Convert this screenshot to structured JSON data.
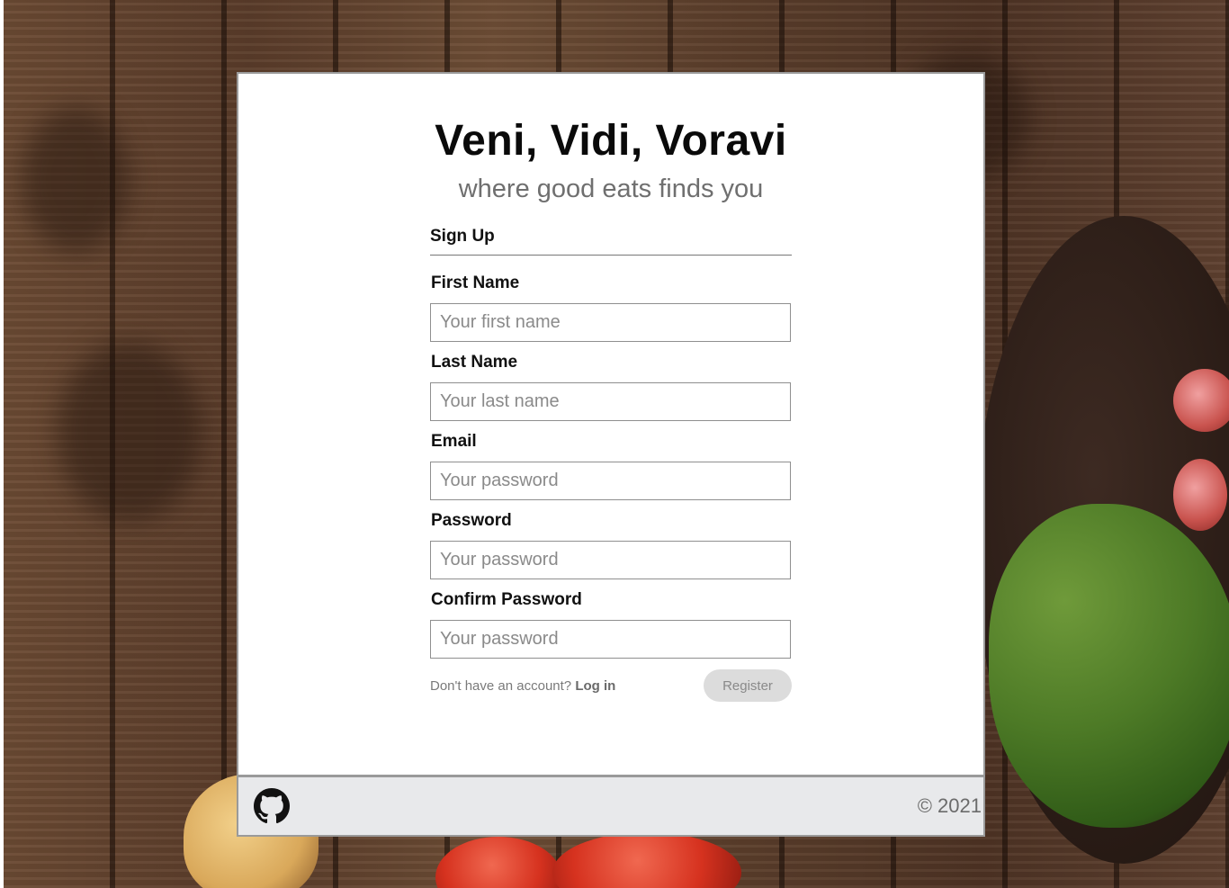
{
  "app": {
    "title": "Veni, Vidi, Voravi",
    "tagline": "where good eats finds you"
  },
  "form": {
    "heading": "Sign Up",
    "fields": [
      {
        "label": "First Name",
        "placeholder": "Your first name",
        "value": ""
      },
      {
        "label": "Last Name",
        "placeholder": "Your last name",
        "value": ""
      },
      {
        "label": "Email",
        "placeholder": "Your password",
        "value": ""
      },
      {
        "label": "Password",
        "placeholder": "Your password",
        "value": ""
      },
      {
        "label": "Confirm Password",
        "placeholder": "Your password",
        "value": ""
      }
    ],
    "login_prompt": "Don't have an account?",
    "login_link": "Log in",
    "register_label": "Register"
  },
  "footer": {
    "icon": "github-icon",
    "copyright": "© 2021"
  },
  "colors": {
    "card_border": "#9a9a9a",
    "footer_bg": "#e8e9eb",
    "button_bg": "#dcdcdc"
  }
}
